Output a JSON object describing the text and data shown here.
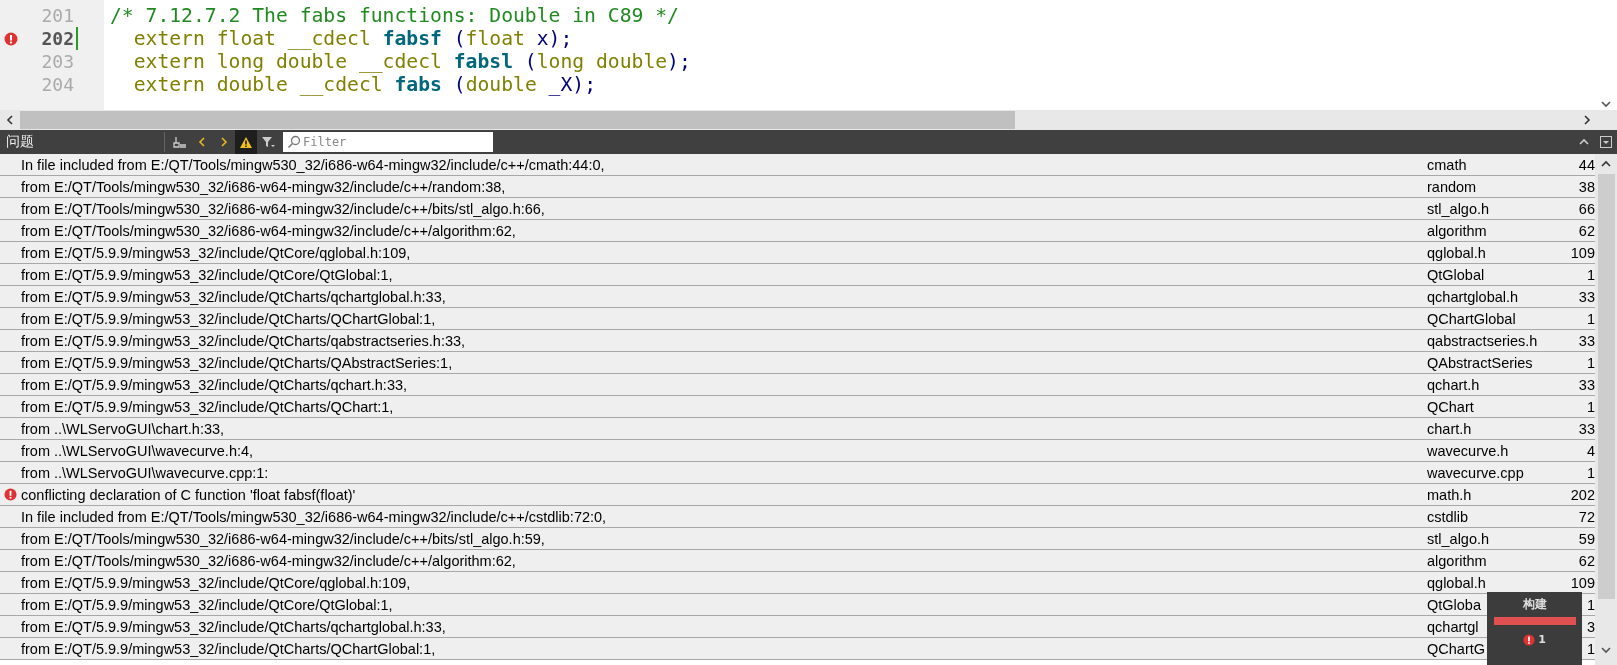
{
  "editor": {
    "lines": [
      {
        "number": "201",
        "current": false,
        "error": false,
        "tokens": [
          {
            "kind": "comment",
            "text": "/* 7.12.7.2 The fabs functions: Double in C89 */"
          }
        ]
      },
      {
        "number": "202",
        "current": true,
        "error": true,
        "tokens": [
          {
            "kind": "keyword",
            "text": "  extern float __cdecl "
          },
          {
            "kind": "func",
            "text": "fabsf"
          },
          {
            "kind": "plain",
            "text": " ("
          },
          {
            "kind": "keyword",
            "text": "float"
          },
          {
            "kind": "plain",
            "text": " x);"
          }
        ]
      },
      {
        "number": "203",
        "current": false,
        "error": false,
        "tokens": [
          {
            "kind": "keyword",
            "text": "  extern long double __cdecl "
          },
          {
            "kind": "func",
            "text": "fabsl"
          },
          {
            "kind": "plain",
            "text": " ("
          },
          {
            "kind": "keyword",
            "text": "long double"
          },
          {
            "kind": "plain",
            "text": ");"
          }
        ]
      },
      {
        "number": "204",
        "current": false,
        "error": false,
        "tokens": [
          {
            "kind": "keyword",
            "text": "  extern double __cdecl "
          },
          {
            "kind": "func",
            "text": "fabs"
          },
          {
            "kind": "plain",
            "text": " ("
          },
          {
            "kind": "keyword",
            "text": "double"
          },
          {
            "kind": "plain",
            "text": " _X);"
          }
        ]
      }
    ]
  },
  "issues_panel": {
    "title": "问题",
    "show_warnings": true,
    "filter": {
      "placeholder": "Filter"
    },
    "rows": [
      {
        "kind": "info",
        "message": "In file included from E:/QT/Tools/mingw530_32/i686-w64-mingw32/include/c++/cmath:44:0,",
        "file": "cmath",
        "line": "44"
      },
      {
        "kind": "info",
        "message": "from E:/QT/Tools/mingw530_32/i686-w64-mingw32/include/c++/random:38,",
        "file": "random",
        "line": "38"
      },
      {
        "kind": "info",
        "message": "from E:/QT/Tools/mingw530_32/i686-w64-mingw32/include/c++/bits/stl_algo.h:66,",
        "file": "stl_algo.h",
        "line": "66"
      },
      {
        "kind": "info",
        "message": "from E:/QT/Tools/mingw530_32/i686-w64-mingw32/include/c++/algorithm:62,",
        "file": "algorithm",
        "line": "62"
      },
      {
        "kind": "info",
        "message": "from E:/QT/5.9.9/mingw53_32/include/QtCore/qglobal.h:109,",
        "file": "qglobal.h",
        "line": "109"
      },
      {
        "kind": "info",
        "message": "from E:/QT/5.9.9/mingw53_32/include/QtCore/QtGlobal:1,",
        "file": "QtGlobal",
        "line": "1"
      },
      {
        "kind": "info",
        "message": "from E:/QT/5.9.9/mingw53_32/include/QtCharts/qchartglobal.h:33,",
        "file": "qchartglobal.h",
        "line": "33"
      },
      {
        "kind": "info",
        "message": "from E:/QT/5.9.9/mingw53_32/include/QtCharts/QChartGlobal:1,",
        "file": "QChartGlobal",
        "line": "1"
      },
      {
        "kind": "info",
        "message": "from E:/QT/5.9.9/mingw53_32/include/QtCharts/qabstractseries.h:33,",
        "file": "qabstractseries.h",
        "line": "33"
      },
      {
        "kind": "info",
        "message": "from E:/QT/5.9.9/mingw53_32/include/QtCharts/QAbstractSeries:1,",
        "file": "QAbstractSeries",
        "line": "1"
      },
      {
        "kind": "info",
        "message": "from E:/QT/5.9.9/mingw53_32/include/QtCharts/qchart.h:33,",
        "file": "qchart.h",
        "line": "33"
      },
      {
        "kind": "info",
        "message": "from E:/QT/5.9.9/mingw53_32/include/QtCharts/QChart:1,",
        "file": "QChart",
        "line": "1"
      },
      {
        "kind": "info",
        "message": "from ..\\WLServoGUI\\chart.h:33,",
        "file": "chart.h",
        "line": "33"
      },
      {
        "kind": "info",
        "message": "from ..\\WLServoGUI\\wavecurve.h:4,",
        "file": "wavecurve.h",
        "line": "4"
      },
      {
        "kind": "info",
        "message": "from ..\\WLServoGUI\\wavecurve.cpp:1:",
        "file": "wavecurve.cpp",
        "line": "1"
      },
      {
        "kind": "error",
        "message": "conflicting declaration of C function 'float fabsf(float)'",
        "file": "math.h",
        "line": "202"
      },
      {
        "kind": "info",
        "message": "In file included from E:/QT/Tools/mingw530_32/i686-w64-mingw32/include/c++/cstdlib:72:0,",
        "file": "cstdlib",
        "line": "72"
      },
      {
        "kind": "info",
        "message": "from E:/QT/Tools/mingw530_32/i686-w64-mingw32/include/c++/bits/stl_algo.h:59,",
        "file": "stl_algo.h",
        "line": "59"
      },
      {
        "kind": "info",
        "message": "from E:/QT/Tools/mingw530_32/i686-w64-mingw32/include/c++/algorithm:62,",
        "file": "algorithm",
        "line": "62"
      },
      {
        "kind": "info",
        "message": "from E:/QT/5.9.9/mingw53_32/include/QtCore/qglobal.h:109,",
        "file": "qglobal.h",
        "line": "109"
      },
      {
        "kind": "info",
        "message": "from E:/QT/5.9.9/mingw53_32/include/QtCore/QtGlobal:1,",
        "file": "QtGloba",
        "line": "1"
      },
      {
        "kind": "info",
        "message": "from E:/QT/5.9.9/mingw53_32/include/QtCharts/qchartglobal.h:33,",
        "file": "qchartgl",
        "line": "3"
      },
      {
        "kind": "info",
        "message": "from E:/QT/5.9.9/mingw53_32/include/QtCharts/QChartGlobal:1,",
        "file": "QChartG",
        "line": "1"
      }
    ]
  },
  "build_popup": {
    "title": "构建",
    "level": 1,
    "errors": "1"
  }
}
